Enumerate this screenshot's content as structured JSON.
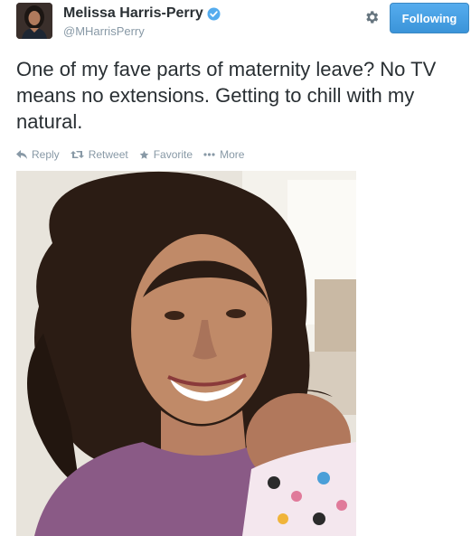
{
  "tweet": {
    "display_name": "Melissa Harris-Perry",
    "handle": "@MHarrisPerry",
    "text": "One of my fave parts of maternity leave? No TV means no extensions. Getting to chill with my natural.",
    "follow_button_label": "Following"
  },
  "actions": {
    "reply_label": "Reply",
    "retweet_label": "Retweet",
    "favorite_label": "Favorite",
    "more_label": "More"
  },
  "icons": {
    "verified": "verified-badge-icon",
    "settings": "gear-icon",
    "reply": "reply-icon",
    "retweet": "retweet-icon",
    "favorite": "star-icon",
    "more": "more-dots-icon"
  },
  "colors": {
    "primary_text": "#292f33",
    "secondary_text": "#8899a6",
    "follow_button": "#55acee",
    "verified_badge": "#55acee"
  }
}
